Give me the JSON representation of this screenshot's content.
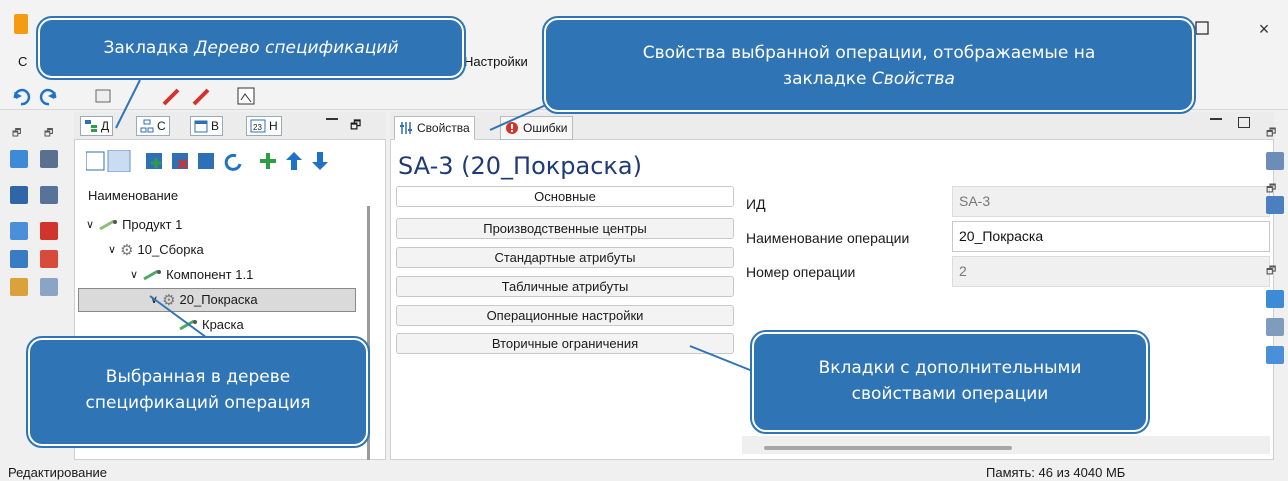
{
  "window": {
    "min_icon": "maximize-icon",
    "close_label": "×"
  },
  "menu": {
    "items": [
      "С",
      "Настройки"
    ]
  },
  "tree_panel": {
    "tabs": [
      {
        "label": "Д",
        "icon": "tree-spec-icon"
      },
      {
        "label": "С",
        "icon": "structure-icon"
      },
      {
        "label": "В",
        "icon": "calendar-icon"
      },
      {
        "label": "Н",
        "icon": "calendar-23-icon"
      }
    ],
    "column_header": "Наименование",
    "rows": [
      {
        "label": "Продукт 1",
        "icon": "product-icon"
      },
      {
        "label": "10_Сборка",
        "icon": "gear-icon"
      },
      {
        "label": "Компонент 1.1",
        "icon": "component-icon"
      },
      {
        "label": "20_Покраска",
        "icon": "gear-icon",
        "selected": true
      },
      {
        "label": "Краска",
        "icon": "material-icon"
      }
    ]
  },
  "properties_panel": {
    "tabs": [
      {
        "label": "Свойства",
        "icon": "properties-icon",
        "active": true
      },
      {
        "label": "Ошибки",
        "icon": "error-icon",
        "active": false
      }
    ],
    "title": "SA-3 (20_Покраска)",
    "categories": [
      "Основные",
      "Производственные центры",
      "Стандартные атрибуты",
      "Табличные атрибуты",
      "Операционные настройки",
      "Вторичные ограничения"
    ],
    "fields": [
      {
        "label": "ИД",
        "value": "SA-3"
      },
      {
        "label": "Наименование операции",
        "value": "20_Покраска"
      },
      {
        "label": "Номер операции",
        "value": "2"
      }
    ]
  },
  "status": {
    "left": "Редактирование",
    "right": "Память: 46 из 4040 МБ"
  },
  "callouts": {
    "tree_tab": {
      "plain": "Закладка ",
      "italic": "Дерево спецификаций"
    },
    "props": {
      "line1": "Свойства выбранной операции, отображаемые на",
      "line2_plain": "закладке ",
      "line2_italic": "Свойства"
    },
    "selected_op": {
      "line1": "Выбранная в дереве",
      "line2": "спецификаций операция"
    },
    "tabs_more": {
      "line1": "Вкладки с дополнительными",
      "line2": "свойствами операции"
    }
  },
  "colors": {
    "callout": "#2f74b5",
    "title": "#1f3b75",
    "accent_green": "#2e9e44",
    "accent_blue": "#1e73c8",
    "accent_red": "#d0342c"
  }
}
